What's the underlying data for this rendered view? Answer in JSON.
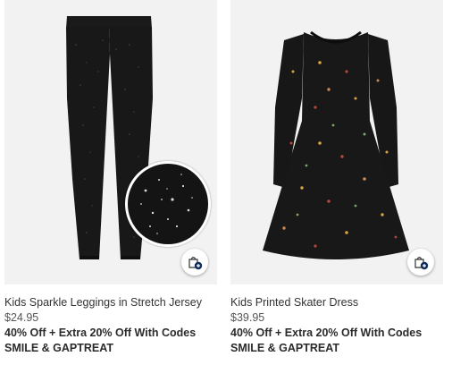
{
  "products": [
    {
      "name": "Kids Sparkle Leggings in Stretch Jersey",
      "price": "$24.95",
      "promo_line1": "40% Off + Extra 20% Off With Codes",
      "promo_line2": "SMILE & GAPTREAT",
      "image_icon": "leggings-image",
      "has_zoom_swatch": true
    },
    {
      "name": "Kids Printed Skater Dress",
      "price": "$39.95",
      "promo_line1": "40% Off + Extra 20% Off With Codes",
      "promo_line2": "SMILE & GAPTREAT",
      "image_icon": "dress-image",
      "has_zoom_swatch": false
    }
  ],
  "icons": {
    "quick_add": "shopping-bag-plus-icon"
  },
  "colors": {
    "tile_background": "#f2f2f2",
    "product_black": "#161616",
    "badge_navy": "#0f2c5c"
  }
}
